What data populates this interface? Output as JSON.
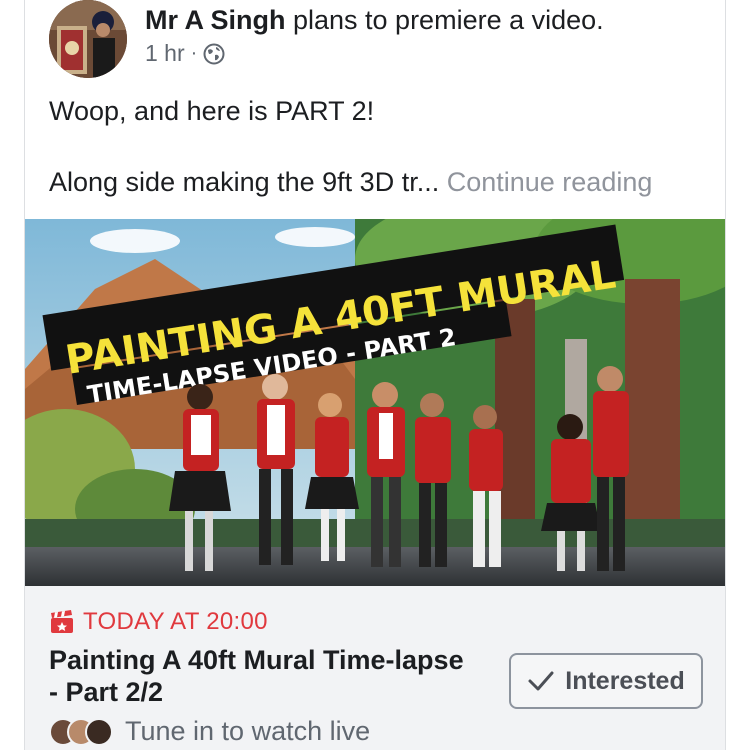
{
  "post": {
    "author": "Mr A Singh",
    "action": " plans to premiere a video.",
    "time": "1 hr",
    "separator": "·",
    "privacy_icon": "globe-icon",
    "text_line1": "Woop, and here is PART 2!",
    "text_line2": "Along side making the 9ft 3D tr...",
    "continue_label": " Continue reading"
  },
  "video": {
    "thumbnail_title": "PAINTING A 40FT MURAL",
    "thumbnail_subtitle": "TIME-LAPSE VIDEO - PART 2"
  },
  "event": {
    "date_label": "TODAY AT 20:00",
    "title": "Painting A 40ft Mural Time-lapse - Part 2/2",
    "interested_label": "Interested",
    "tune_in_label": "Tune in to watch live"
  },
  "colors": {
    "accent_red": "#e0393e",
    "thumbnail_yellow": "#f5e23a",
    "meta_gray": "#606770"
  }
}
